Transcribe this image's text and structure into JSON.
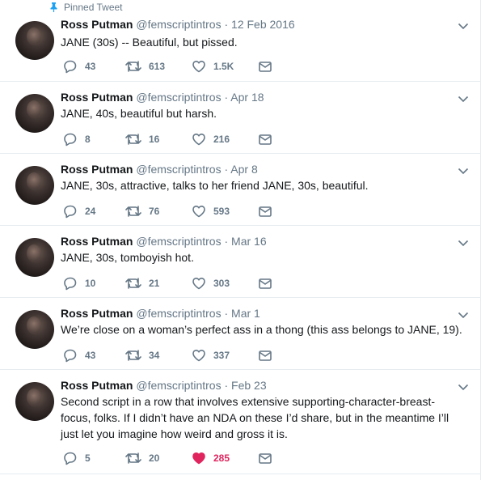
{
  "pinned_label": "Pinned Tweet",
  "tweets": [
    {
      "name": "Ross Putman",
      "handle": "@femscriptintros",
      "separator": "·",
      "date": "12 Feb 2016",
      "text": "JANE (30s) -- Beautiful, but pissed.",
      "replies": "43",
      "retweets": "613",
      "likes": "1.5K",
      "liked": false
    },
    {
      "name": "Ross Putman",
      "handle": "@femscriptintros",
      "separator": "·",
      "date": "Apr 18",
      "text": "JANE, 40s, beautiful but harsh.",
      "replies": "8",
      "retweets": "16",
      "likes": "216",
      "liked": false
    },
    {
      "name": "Ross Putman",
      "handle": "@femscriptintros",
      "separator": "·",
      "date": "Apr 8",
      "text": "JANE, 30s, attractive, talks to her friend JANE, 30s, beautiful.",
      "replies": "24",
      "retweets": "76",
      "likes": "593",
      "liked": false
    },
    {
      "name": "Ross Putman",
      "handle": "@femscriptintros",
      "separator": "·",
      "date": "Mar 16",
      "text": "JANE, 30s, tomboyish hot.",
      "replies": "10",
      "retweets": "21",
      "likes": "303",
      "liked": false
    },
    {
      "name": "Ross Putman",
      "handle": "@femscriptintros",
      "separator": "·",
      "date": "Mar 1",
      "text": "We’re close on a woman’s perfect ass in a thong (this ass belongs to JANE, 19).",
      "replies": "43",
      "retweets": "34",
      "likes": "337",
      "liked": false
    },
    {
      "name": "Ross Putman",
      "handle": "@femscriptintros",
      "separator": "·",
      "date": "Feb 23",
      "text": "Second script in a row that involves extensive supporting-character-breast-focus, folks. If I didn’t have an NDA on these I’d share, but in the meantime I’ll just let you imagine how weird and gross it is.",
      "replies": "5",
      "retweets": "20",
      "likes": "285",
      "liked": true
    }
  ],
  "colors": {
    "muted": "#657786",
    "text": "#14171a",
    "like_active": "#e0245e",
    "divider": "#e6ecf0",
    "pin": "#1da1f2"
  },
  "icons": {
    "pin": "pin-icon",
    "reply": "reply-icon",
    "retweet": "retweet-icon",
    "like": "heart-icon",
    "dm": "envelope-icon",
    "more": "chevron-down-icon"
  }
}
